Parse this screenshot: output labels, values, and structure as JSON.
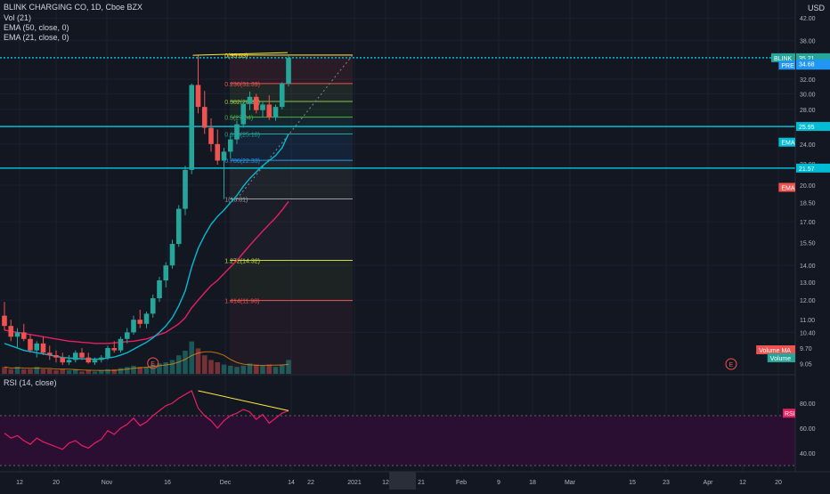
{
  "header": {
    "symbol_line": "BLINK CHARGING CO, 1D, Cboe BZX",
    "indicators": [
      "Vol (21)",
      "EMA (50, close, 0)",
      "EMA (21, close, 0)"
    ],
    "currency": "USD"
  },
  "rsi_label": "RSI (14, close)",
  "price_axis": {
    "ticks": [
      "42.00",
      "38.00",
      "34.68",
      "32.00",
      "30.00",
      "28.00",
      "26.00",
      "24.00",
      "22.00",
      "20.00",
      "18.50",
      "17.00",
      "15.50",
      "14.00",
      "13.00",
      "12.00",
      "11.00",
      "10.40",
      "9.70",
      "9.05"
    ],
    "badges": [
      {
        "label": "BLINK",
        "value": "35.21",
        "color": "#26a69a"
      },
      {
        "label": "PRE",
        "value": "35.30",
        "color": "#2196f3"
      },
      {
        "label": "",
        "value": "34.68",
        "color": "#2196f3"
      },
      {
        "label": "",
        "value": "25.95",
        "color": "#00bcd4"
      },
      {
        "label": "EMA",
        "value": "",
        "color": "#00bcd4"
      },
      {
        "label": "",
        "value": "21.57",
        "color": "#00bcd4"
      },
      {
        "label": "EMA",
        "value": "",
        "color": "#ef5350"
      },
      {
        "label": "Volume MA",
        "value": "",
        "color": "#ef5350"
      },
      {
        "label": "Volume",
        "value": "",
        "color": "#26a69a"
      }
    ]
  },
  "rsi_axis": {
    "ticks": [
      "80.00",
      "60.00",
      "40.00"
    ],
    "badge": "RSI"
  },
  "time_axis": {
    "labels": [
      "12",
      "20",
      "Nov",
      "16",
      "Dec",
      "14",
      "22",
      "2021",
      "12",
      "21",
      "Feb",
      "9",
      "18",
      "Mar",
      "15",
      "23",
      "Apr",
      "12",
      "20"
    ]
  },
  "fib_levels": [
    {
      "label": "0(35.63)",
      "color": "#ffeb3b"
    },
    {
      "label": "0.236(31.39)",
      "color": "#ef5350"
    },
    {
      "label": "0.382(28.99)",
      "color": "#8bc34a"
    },
    {
      "label": "0.5(27.04)",
      "color": "#4caf50"
    },
    {
      "label": "0.618(25.10)",
      "color": "#26a69a"
    },
    {
      "label": "0.786(22.33)",
      "color": "#2196f3"
    },
    {
      "label": "1(18.81)",
      "color": "#9e9e9e"
    },
    {
      "label": "1.272(14.32)",
      "color": "#cddc39"
    },
    {
      "label": "1.414(11.98)",
      "color": "#ef5350"
    }
  ],
  "earnings_marker": "E",
  "colors": {
    "up": "#26a69a",
    "down": "#ef5350",
    "ema21": "#00bcd4",
    "ema50": "#e91e63",
    "hline": "#00bcd4",
    "trend": "#ffeb3b",
    "rsi": "#e91e63",
    "rsi_band": "#2a0f33"
  },
  "chart_data": {
    "type": "candlestick",
    "candles": [
      [
        11.2,
        11.9,
        10.5,
        10.7
      ],
      [
        10.7,
        11.0,
        10.0,
        10.2
      ],
      [
        10.2,
        10.6,
        9.7,
        10.4
      ],
      [
        10.4,
        10.8,
        10.0,
        10.1
      ],
      [
        10.1,
        10.3,
        9.5,
        9.6
      ],
      [
        9.6,
        10.0,
        9.3,
        9.9
      ],
      [
        9.9,
        10.2,
        9.4,
        9.5
      ],
      [
        9.5,
        9.8,
        9.2,
        9.4
      ],
      [
        9.4,
        9.6,
        9.1,
        9.3
      ],
      [
        9.3,
        9.5,
        9.0,
        9.1
      ],
      [
        9.1,
        9.4,
        9.0,
        9.2
      ],
      [
        9.2,
        9.6,
        9.1,
        9.5
      ],
      [
        9.5,
        9.7,
        9.2,
        9.3
      ],
      [
        9.3,
        9.5,
        9.05,
        9.1
      ],
      [
        9.1,
        9.3,
        9.0,
        9.2
      ],
      [
        9.2,
        9.4,
        9.1,
        9.3
      ],
      [
        9.3,
        9.8,
        9.2,
        9.7
      ],
      [
        9.7,
        10.0,
        9.5,
        9.6
      ],
      [
        9.6,
        10.2,
        9.5,
        10.1
      ],
      [
        10.1,
        10.6,
        9.9,
        10.4
      ],
      [
        10.4,
        11.2,
        10.3,
        11.0
      ],
      [
        11.0,
        11.5,
        10.6,
        10.8
      ],
      [
        10.8,
        11.4,
        10.6,
        11.3
      ],
      [
        11.3,
        12.3,
        11.1,
        12.1
      ],
      [
        12.1,
        13.3,
        11.9,
        13.1
      ],
      [
        13.1,
        14.2,
        12.7,
        14.0
      ],
      [
        14.0,
        15.7,
        13.8,
        15.4
      ],
      [
        15.4,
        18.3,
        15.2,
        18.0
      ],
      [
        18.0,
        21.8,
        17.5,
        21.4
      ],
      [
        21.4,
        31.4,
        21.0,
        31.2
      ],
      [
        31.2,
        35.6,
        27.5,
        28.3
      ],
      [
        28.3,
        30.4,
        25.1,
        25.8
      ],
      [
        25.8,
        26.9,
        23.2,
        24.0
      ],
      [
        24.0,
        25.6,
        21.9,
        22.3
      ],
      [
        22.3,
        23.6,
        18.8,
        23.2
      ],
      [
        23.2,
        24.9,
        22.5,
        24.5
      ],
      [
        24.5,
        26.6,
        24.0,
        26.2
      ],
      [
        26.2,
        29.0,
        25.8,
        28.7
      ],
      [
        28.7,
        30.3,
        27.9,
        29.6
      ],
      [
        29.6,
        30.0,
        27.5,
        27.9
      ],
      [
        27.9,
        28.9,
        27.0,
        28.6
      ],
      [
        28.6,
        29.8,
        26.7,
        27.0
      ],
      [
        27.0,
        28.6,
        26.6,
        28.3
      ],
      [
        28.3,
        31.6,
        28.0,
        31.4
      ],
      [
        31.4,
        35.6,
        31.0,
        35.2
      ]
    ],
    "ema21": [
      9.9,
      9.8,
      9.7,
      9.6,
      9.55,
      9.5,
      9.45,
      9.4,
      9.35,
      9.3,
      9.28,
      9.26,
      9.25,
      9.24,
      9.23,
      9.24,
      9.28,
      9.32,
      9.4,
      9.5,
      9.65,
      9.8,
      9.95,
      10.15,
      10.4,
      10.7,
      11.1,
      11.7,
      12.5,
      13.9,
      15.1,
      16.0,
      16.8,
      17.4,
      17.9,
      18.5,
      19.1,
      19.9,
      20.6,
      21.2,
      21.8,
      22.3,
      22.8,
      23.6,
      25.1
    ],
    "ema50": [
      10.5,
      10.45,
      10.4,
      10.35,
      10.3,
      10.25,
      10.2,
      10.15,
      10.1,
      10.05,
      10.0,
      9.98,
      9.95,
      9.93,
      9.9,
      9.9,
      9.9,
      9.92,
      9.95,
      9.98,
      10.0,
      10.05,
      10.1,
      10.2,
      10.3,
      10.4,
      10.6,
      10.8,
      11.1,
      11.6,
      12.0,
      12.4,
      12.8,
      13.1,
      13.5,
      13.9,
      14.3,
      14.8,
      15.3,
      15.8,
      16.3,
      16.8,
      17.3,
      17.9,
      18.6
    ],
    "rsi": [
      56,
      52,
      54,
      50,
      47,
      52,
      49,
      47,
      45,
      43,
      48,
      50,
      46,
      44,
      48,
      51,
      58,
      55,
      60,
      63,
      68,
      62,
      65,
      70,
      74,
      78,
      80,
      84,
      87,
      90,
      76,
      70,
      66,
      60,
      66,
      70,
      72,
      75,
      73,
      67,
      71,
      64,
      68,
      72,
      74
    ],
    "horizontal_lines": [
      35.21,
      25.95,
      21.57
    ],
    "trend_line_price": [
      [
        30,
        35.6
      ],
      [
        44,
        35.6
      ]
    ],
    "trend_line_rsi": [
      [
        30,
        90
      ],
      [
        44,
        74
      ]
    ]
  }
}
